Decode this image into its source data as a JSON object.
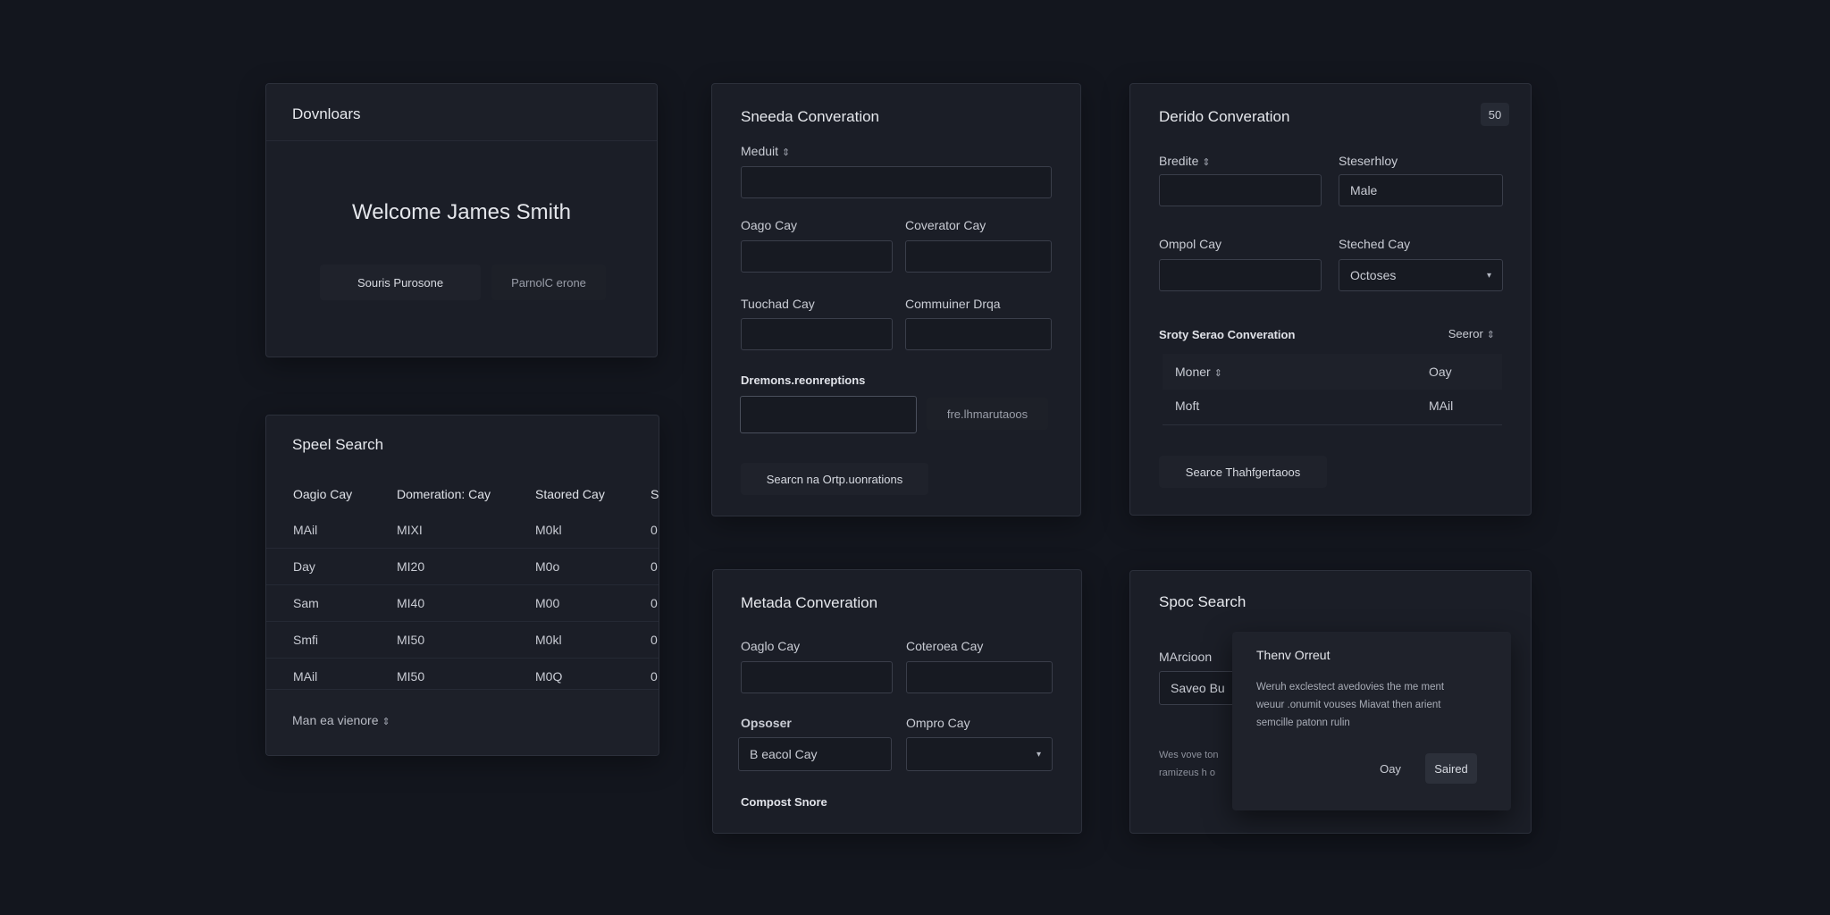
{
  "downloads_card": {
    "title": "Dovnloars",
    "welcome": "Welcome James Smith",
    "primary_button": "Souris Purosone",
    "secondary_button": "ParnolC erone"
  },
  "speel_search_card": {
    "title": "Speel Search",
    "columns": [
      "Oagio Cay",
      "Domeration: Cay",
      "Staored Cay",
      "S"
    ],
    "rows": [
      [
        "MAil",
        "MIXI",
        "M0kl",
        "0"
      ],
      [
        "Day",
        "MI20",
        "M0o",
        "0"
      ],
      [
        "Sam",
        "MI40",
        "M00",
        "0"
      ],
      [
        "Smfi",
        "MI50",
        "M0kl",
        "0"
      ],
      [
        "MAil",
        "MI50",
        "M0Q",
        "0"
      ]
    ],
    "footer": "Man ea vienore",
    "footer_icon": "sort-icon"
  },
  "sneeda_card": {
    "title": "Sneeda Converation",
    "field1_label": "Meduit",
    "field1_value": "",
    "field2_label": "Oago Cay",
    "field2_value": "",
    "field3_label": "Coverator Cay",
    "field3_value": "",
    "field4_label": "Tuochad Cay",
    "field4_value": "",
    "field5_label": "Commuiner Drqa",
    "field5_value": "",
    "section_label": "Dremons.reonreptions",
    "section_value": "",
    "section_link": "fre.lhmarutaoos",
    "submit_button": "Searcn na Ortp.uonrations"
  },
  "derido_card": {
    "title": "Derido Converation",
    "badge": "50",
    "field1_label": "Bredite",
    "field1_value": "",
    "field2_label": "Steserhloy",
    "field2_value": "Male",
    "field3_label": "Ompol Cay",
    "field3_value": "",
    "field4_label": "Steched Cay",
    "field4_value": "Octoses",
    "subsection_title": "Sroty Serao Converation",
    "subsection_action": "Seeror",
    "list_rows": [
      {
        "left": "Moner",
        "right": "Oay"
      },
      {
        "left": "Moft",
        "right": "MAil"
      }
    ],
    "footer_button": "Searce Thahfgertaoos"
  },
  "metada_card": {
    "title": "Metada Converation",
    "field1_label": "Oaglo Cay",
    "field1_value": "",
    "field2_label": "Coteroea Cay",
    "field2_value": "",
    "field3_label": "Opsoser",
    "field3_value": "B eacol Cay",
    "field4_label": "Ompro Cay",
    "field4_value": "",
    "footer_label": "Compost Snore"
  },
  "spoc_search_card": {
    "title": "Spoc Search",
    "field_label": "MArcioon",
    "field_value": "Saveo Bu",
    "text_line1": "Wes vove ton",
    "text_line2": "ramizeus h o",
    "dialog": {
      "title": "Thenv Orreut",
      "body_line1": "Weruh exclestect avedovies the me ment",
      "body_line2": "weuur .onumit vouses Miavat then arient",
      "body_line3": "semcille patonn rulin",
      "cancel_button": "Oay",
      "confirm_button": "Saired"
    }
  }
}
